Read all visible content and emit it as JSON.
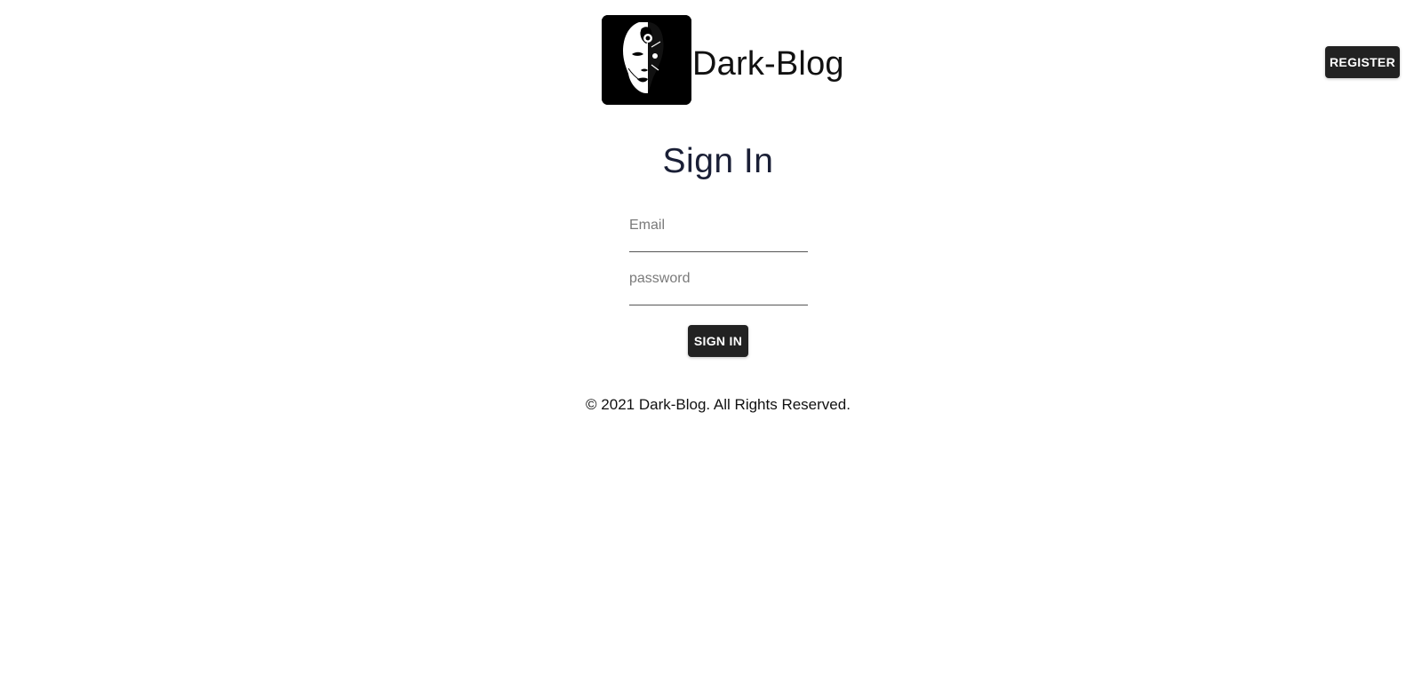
{
  "header": {
    "brand_name": "Dark-Blog",
    "logo_icon": "face-mask-logo",
    "register_label": "REGISTER"
  },
  "main": {
    "title": "Sign In",
    "email": {
      "placeholder": "Email",
      "value": ""
    },
    "password": {
      "placeholder": "password",
      "value": ""
    },
    "signin_label": "SIGN IN"
  },
  "footer": {
    "copyright": "© 2021 Dark-Blog. All Rights Reserved."
  },
  "colors": {
    "button_bg": "#222222",
    "button_text": "#ffffff",
    "title": "#1a1f36",
    "logo_bg": "#000000"
  }
}
